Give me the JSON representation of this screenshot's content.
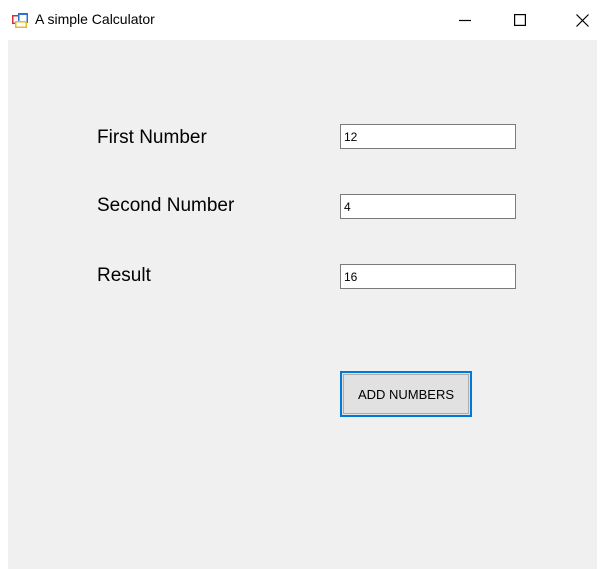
{
  "window": {
    "title": "A simple Calculator",
    "app_icon": "winforms-app-icon",
    "controls": {
      "minimize_icon": "minimize-icon",
      "maximize_icon": "maximize-icon",
      "close_icon": "close-icon"
    }
  },
  "form": {
    "first_number": {
      "label": "First Number",
      "value": "12"
    },
    "second_number": {
      "label": "Second Number",
      "value": "4"
    },
    "result": {
      "label": "Result",
      "value": "16"
    },
    "add_button_label": "ADD NUMBERS"
  },
  "colors": {
    "client_background": "#f0f0f0",
    "button_focus_border": "#0078d7",
    "button_face": "#e1e1e1"
  }
}
